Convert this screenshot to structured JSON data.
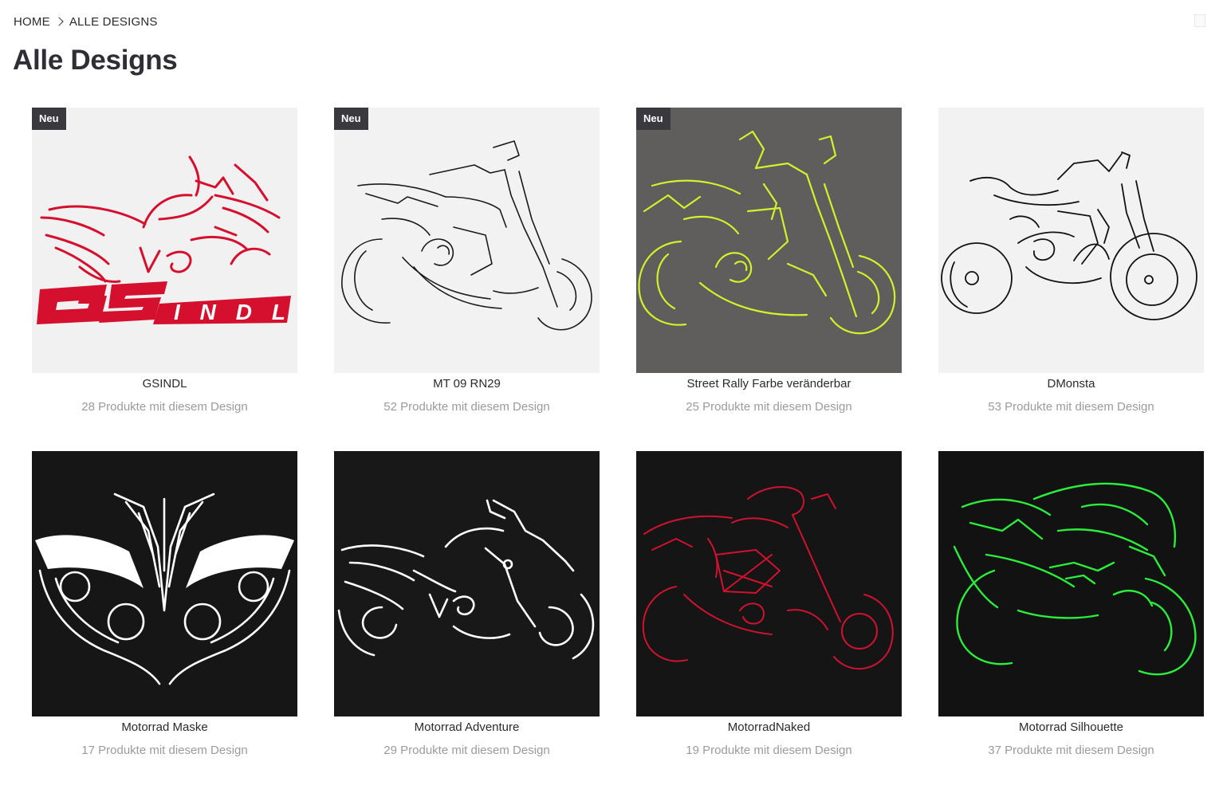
{
  "breadcrumb": {
    "home": "HOME",
    "current": "ALLE DESIGNS",
    "separator_icon": "chevron-right-icon"
  },
  "page_title": "Alle Designs",
  "designs": [
    {
      "name": "GSINDL",
      "count": "28 Produkte mit diesem Design",
      "badge": "Neu",
      "background": "#f1f1f1",
      "line_color": "#d5102e",
      "logo_text": "GSINDL"
    },
    {
      "name": "MT 09 RN29",
      "count": "52 Produkte mit diesem Design",
      "badge": "Neu",
      "background": "#f2f2f2",
      "line_color": "#1a1a1a"
    },
    {
      "name": "Street Rally Farbe veränderbar",
      "count": "25 Produkte mit diesem Design",
      "badge": "Neu",
      "background": "#5f5e5c",
      "line_color": "#d4f12a"
    },
    {
      "name": "DMonsta",
      "count": "53 Produkte mit diesem Design",
      "badge": "",
      "background": "#f2f2f2",
      "line_color": "#111111"
    },
    {
      "name": "Motorrad Maske",
      "count": "17 Produkte mit diesem Design",
      "badge": "",
      "background": "#161616",
      "line_color": "#ffffff"
    },
    {
      "name": "Motorrad Adventure",
      "count": "29 Produkte mit diesem Design",
      "badge": "",
      "background": "#181818",
      "line_color": "#ffffff"
    },
    {
      "name": "MotorradNaked",
      "count": "19 Produkte mit diesem Design",
      "badge": "",
      "background": "#151515",
      "line_color": "#d0122f"
    },
    {
      "name": "Motorrad Silhouette",
      "count": "37 Produkte mit diesem Design",
      "badge": "",
      "background": "#121212",
      "line_color": "#2bed3c"
    }
  ]
}
